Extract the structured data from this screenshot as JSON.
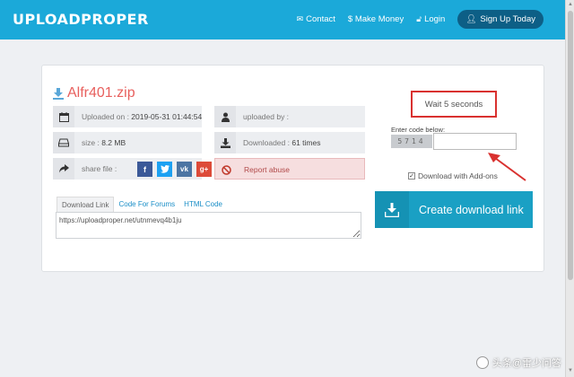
{
  "header": {
    "logo": "UPLOADPROPER",
    "nav": {
      "contact": "Contact",
      "make_money": "$ Make Money",
      "login": "Login",
      "signup": "Sign Up Today"
    }
  },
  "file": {
    "name": "Alfr401.zip",
    "uploaded_on_label": "Uploaded on : ",
    "uploaded_on": "2019-05-31 01:44:54",
    "uploaded_by_label": "uploaded by :",
    "size_label": "size : ",
    "size": "8.2 MB",
    "downloaded_label": "Downloaded : ",
    "downloaded": "61 times",
    "share_label": "share file :",
    "report": "Report abuse"
  },
  "tabs": [
    "Download Link",
    "Code For Forums",
    "HTML Code"
  ],
  "link": "https://uploadproper.net/utnmevq4b1ju",
  "download": {
    "wait": "Wait 5 seconds",
    "code_label": "Enter code below:",
    "captcha": "5714",
    "addons": "Download with Add-ons",
    "create": "Create download link"
  },
  "watermark": "头条@雷少问答",
  "colors": {
    "header": "#1ba9d9",
    "accent_red": "#e8605e",
    "button": "#1aa0c4",
    "highlight": "#d9312f"
  }
}
